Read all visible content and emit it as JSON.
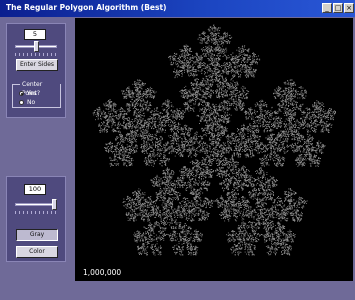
{
  "window": {
    "title": "The Regular Polygon Algorithm (Best)",
    "controls": {
      "minimize": "_",
      "maximize": "□",
      "close": "×"
    }
  },
  "sides_panel": {
    "sides_value": "5",
    "sides_slider_fraction": 0.5,
    "enter_button": "Enter Sides",
    "center_group_label": "Center Point?",
    "center_options": [
      {
        "label": "Yes",
        "selected": true
      },
      {
        "label": "No",
        "selected": false
      }
    ]
  },
  "color_panel": {
    "brightness_value": "100",
    "brightness_slider_fraction": 1.0,
    "gray_button": "Gray",
    "color_button": "Color"
  },
  "canvas": {
    "point_count": "1,000,000",
    "background_color": "#000000",
    "point_color": "#ffffff"
  }
}
